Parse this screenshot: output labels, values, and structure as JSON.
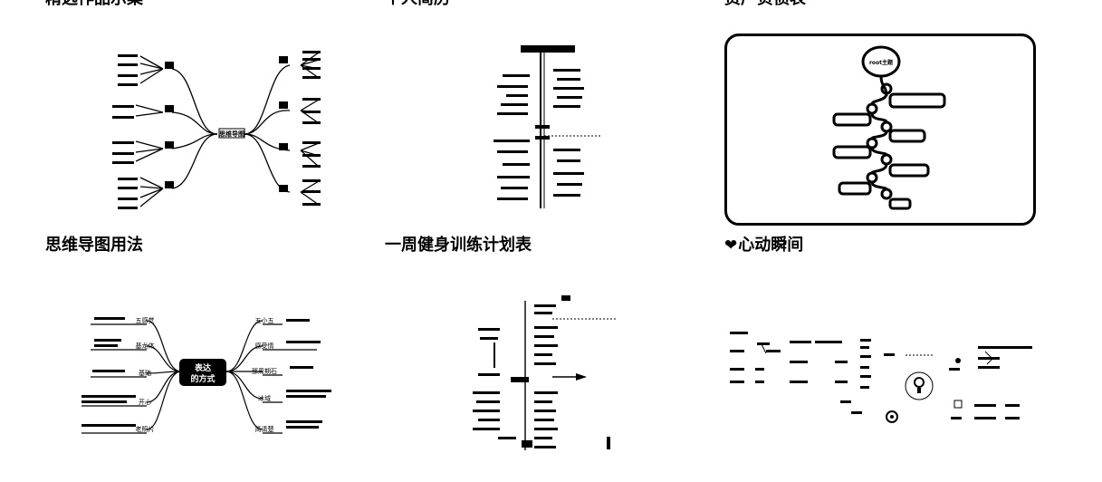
{
  "templates": [
    {
      "title": "精选作品示集",
      "preview": "mindmap-icons"
    },
    {
      "title": "个人简历",
      "preview": "timeline-resume"
    },
    {
      "title": "资产负债表",
      "preview": "flow-balance",
      "selected": true
    },
    {
      "title": "思维导图用法",
      "preview": "mindmap-method"
    },
    {
      "title": "一周健身训练计划表",
      "preview": "fitness-tree"
    },
    {
      "title": "心动瞬间",
      "title_icon": "heart-icon",
      "preview": "moments-map"
    }
  ],
  "previews": {
    "mindmap_icons_center": "思维导图",
    "flow_root": "root主题",
    "method_center_line1": "表达",
    "method_center_line2": "的方式",
    "method_branches_left": [
      "五感觉",
      "基龙体",
      "基础",
      "开心",
      "老照片"
    ],
    "method_branches_right": [
      "五小五",
      "感受情",
      "那周期石",
      "冰域",
      "简清楚"
    ]
  },
  "colors": {
    "selected_border": "#000000",
    "ink": "#000000",
    "bg": "#ffffff"
  }
}
